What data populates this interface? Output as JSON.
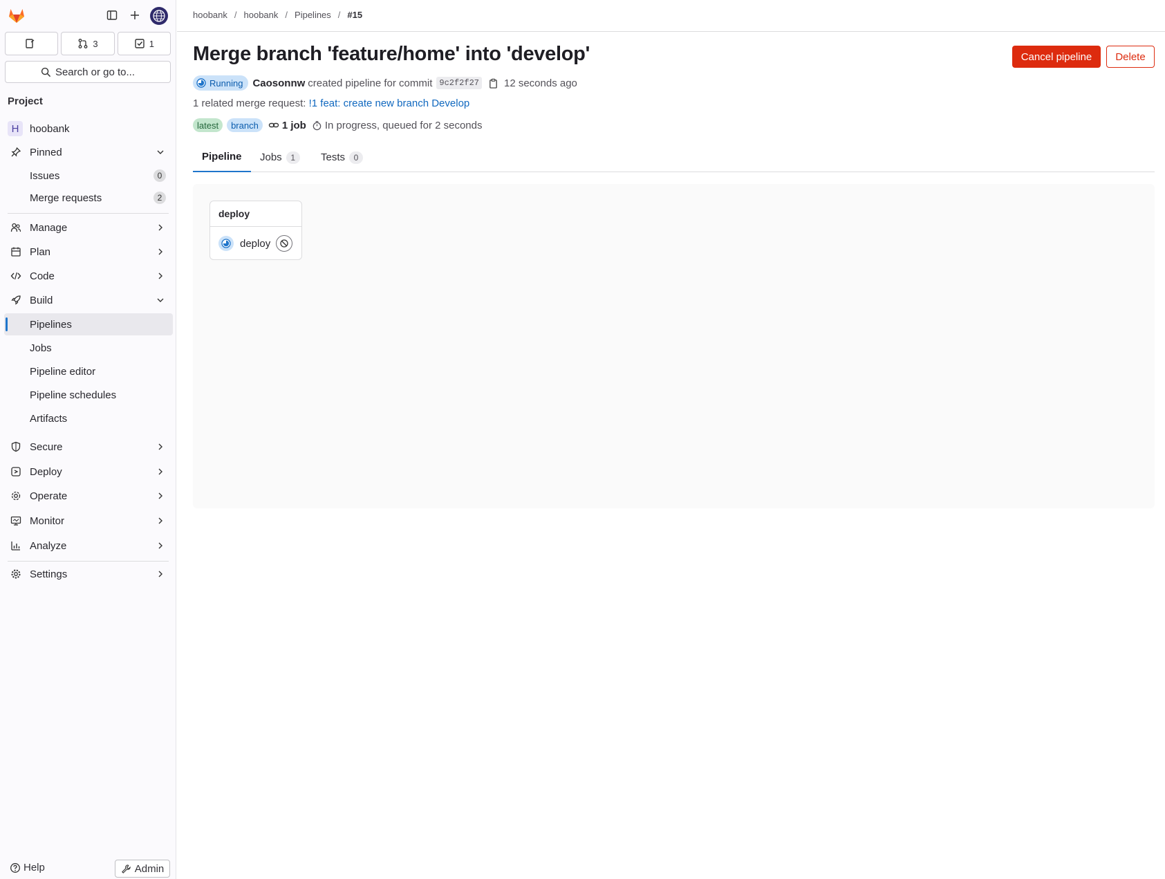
{
  "sidebar": {
    "counters": [
      {
        "icon": "issues-icon",
        "value": ""
      },
      {
        "icon": "merge-request-icon",
        "value": "3"
      },
      {
        "icon": "todo-icon",
        "value": "1"
      }
    ],
    "search_label": "Search or go to...",
    "section_title": "Project",
    "project": {
      "initial": "H",
      "name": "hoobank"
    },
    "pinned": {
      "label": "Pinned",
      "items": [
        {
          "label": "Issues",
          "count": "0"
        },
        {
          "label": "Merge requests",
          "count": "2"
        }
      ]
    },
    "groups": {
      "manage": "Manage",
      "plan": "Plan",
      "code": "Code",
      "build": "Build",
      "secure": "Secure",
      "deploy": "Deploy",
      "operate": "Operate",
      "monitor": "Monitor",
      "analyze": "Analyze",
      "settings": "Settings"
    },
    "build_items": {
      "pipelines": "Pipelines",
      "jobs": "Jobs",
      "pipeline_editor": "Pipeline editor",
      "pipeline_schedules": "Pipeline schedules",
      "artifacts": "Artifacts"
    },
    "help": "Help",
    "admin": "Admin"
  },
  "breadcrumb": [
    "hoobank",
    "hoobank",
    "Pipelines",
    "#15"
  ],
  "pipeline": {
    "title": "Merge branch 'feature/home' into 'develop'",
    "status": "Running",
    "author": "Caosonnw",
    "created_text": "created pipeline for commit",
    "sha": "9c2f2f27",
    "time_ago": "12 seconds ago",
    "related_prefix": "1 related merge request:",
    "related_link": "!1 feat: create new branch Develop",
    "tags": [
      "latest",
      "branch"
    ],
    "jobs_count": "1 job",
    "progress_text": "In progress, queued for 2 seconds"
  },
  "actions": {
    "cancel": "Cancel pipeline",
    "delete": "Delete"
  },
  "tabs": [
    {
      "label": "Pipeline",
      "count": ""
    },
    {
      "label": "Jobs",
      "count": "1"
    },
    {
      "label": "Tests",
      "count": "0"
    }
  ],
  "graph": {
    "stage_name": "deploy",
    "job_name": "deploy"
  },
  "colors": {
    "accent": "#1f75cb",
    "danger": "#dd2b0e",
    "running": "#1f75cb"
  }
}
